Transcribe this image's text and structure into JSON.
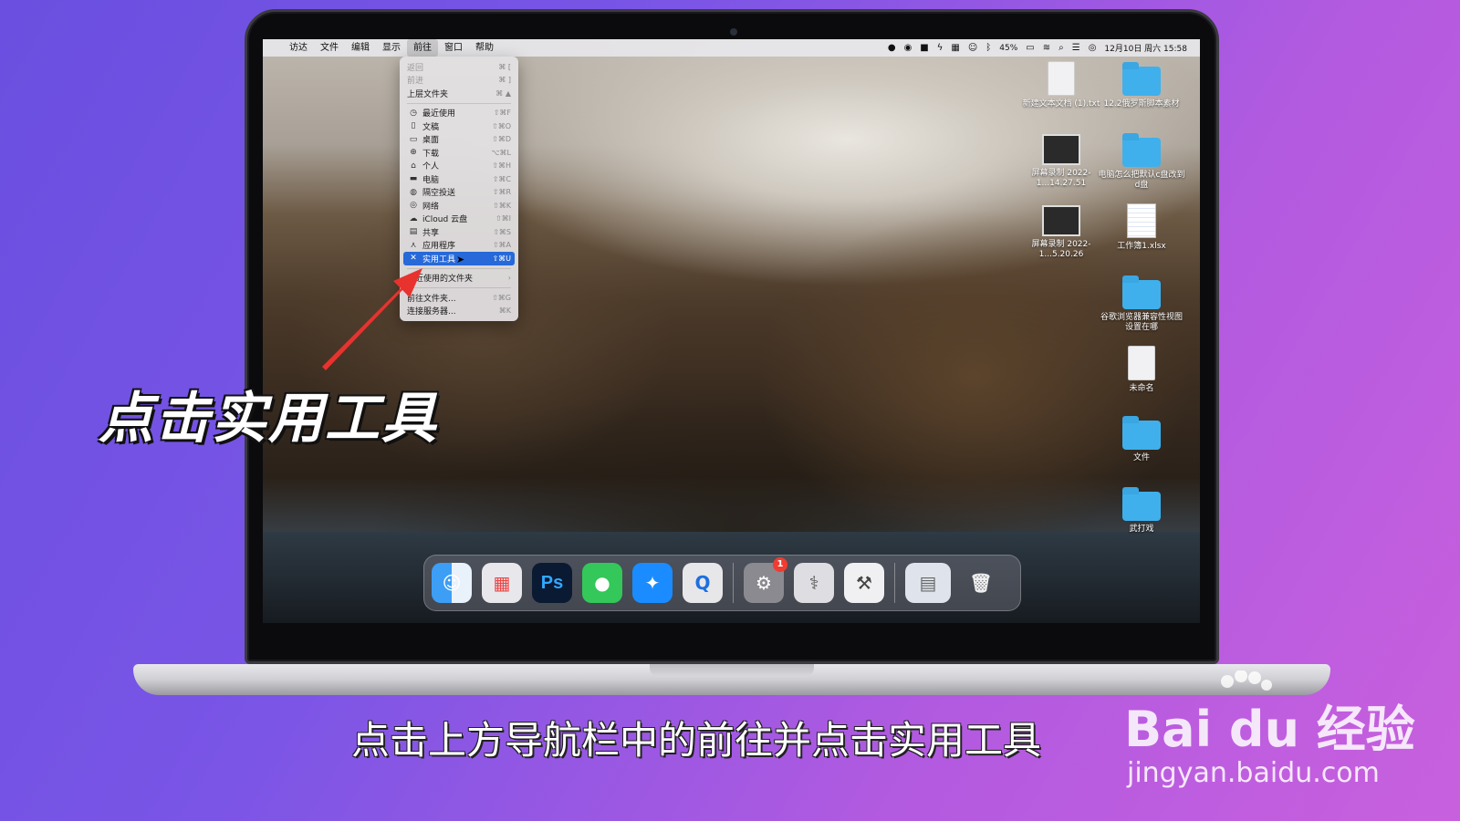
{
  "menubar": {
    "items": [
      "访达",
      "文件",
      "编辑",
      "显示",
      "前往",
      "窗口",
      "帮助"
    ],
    "active_item": "前往",
    "battery": "45%",
    "datetime": "12月10日 周六 15:58"
  },
  "go_menu": {
    "back": {
      "label": "返回",
      "shortcut": "⌘ ["
    },
    "forward": {
      "label": "前进",
      "shortcut": "⌘ ]"
    },
    "enclosing": {
      "label": "上层文件夹",
      "shortcut": "⌘ ▲"
    },
    "recents": {
      "label": "最近使用",
      "shortcut": "⇧⌘F"
    },
    "documents": {
      "label": "文稿",
      "shortcut": "⇧⌘O"
    },
    "desktop": {
      "label": "桌面",
      "shortcut": "⇧⌘D"
    },
    "downloads": {
      "label": "下载",
      "shortcut": "⌥⌘L"
    },
    "home": {
      "label": "个人",
      "shortcut": "⇧⌘H"
    },
    "computer": {
      "label": "电脑",
      "shortcut": "⇧⌘C"
    },
    "airdrop": {
      "label": "隔空投送",
      "shortcut": "⇧⌘R"
    },
    "network": {
      "label": "网络",
      "shortcut": "⇧⌘K"
    },
    "icloud": {
      "label": "iCloud 云盘",
      "shortcut": "⇧⌘I"
    },
    "shared": {
      "label": "共享",
      "shortcut": "⇧⌘S"
    },
    "applications": {
      "label": "应用程序",
      "shortcut": "⇧⌘A"
    },
    "utilities": {
      "label": "实用工具",
      "shortcut": "⇧⌘U"
    },
    "recent_folders": {
      "label": "最近使用的文件夹",
      "arrow": "›"
    },
    "go_to_folder": {
      "label": "前往文件夹...",
      "shortcut": "⇧⌘G"
    },
    "connect_server": {
      "label": "连接服务器...",
      "shortcut": "⌘K"
    }
  },
  "desktop_icons": [
    {
      "label": "新建文本文档 (1).txt"
    },
    {
      "label": "12.2俄罗斯脚本素材"
    },
    {
      "label": "屏幕录制 2022-1...14.27.51"
    },
    {
      "label": "电脑怎么把默认c盘改到d盘"
    },
    {
      "label": "屏幕录制 2022-1...5.20.26"
    },
    {
      "label": "工作簿1.xlsx"
    },
    {
      "label": "谷歌浏览器兼容性视图设置在哪"
    },
    {
      "label": "未命名"
    },
    {
      "label": "文件"
    },
    {
      "label": "武打戏"
    }
  ],
  "dock": {
    "photoshop_label": "Ps",
    "settings_badge": "1"
  },
  "annotation": {
    "big_caption": "点击实用工具",
    "subtitle": "点击上方导航栏中的前往并点击实用工具"
  },
  "watermark": {
    "logo": "Bai du 经验",
    "url": "jingyan.baidu.com"
  },
  "colors": {
    "background_start": "#6a4fe0",
    "background_end": "#c860de",
    "menu_highlight": "#2769d8",
    "folder": "#3fb0ec",
    "badge": "#f23b30"
  }
}
